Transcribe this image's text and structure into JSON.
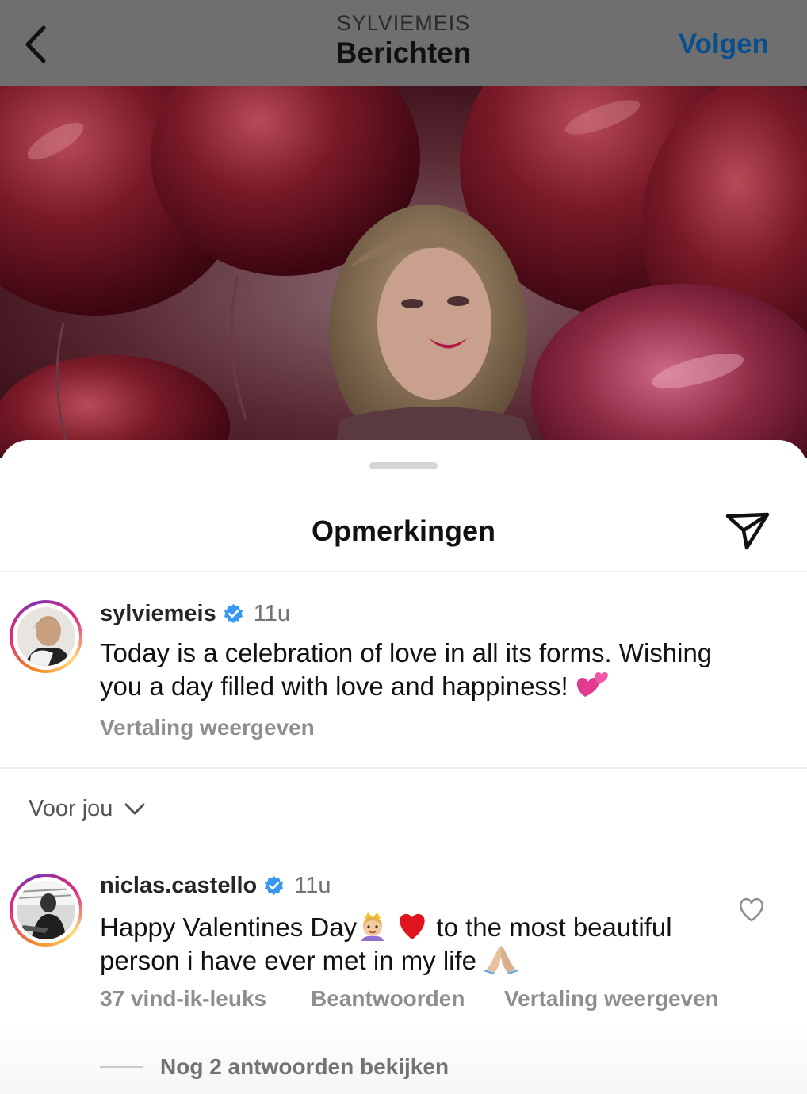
{
  "header": {
    "subtitle": "SYLVIEMEIS",
    "title": "Berichten",
    "follow_label": "Volgen",
    "back_icon": "chevron-left-icon"
  },
  "sheet": {
    "title": "Opmerkingen",
    "share_icon": "send-icon"
  },
  "caption": {
    "username": "sylviemeis",
    "verified": true,
    "time": "11u",
    "text_line1": "Today is a celebration of love in all its forms. Wishing",
    "text_line2": "you a day filled with love and happiness! ",
    "emoji": "two-hearts",
    "translate_label": "Vertaling weergeven"
  },
  "sort": {
    "label": "Voor jou",
    "icon": "chevron-down-icon"
  },
  "comments": [
    {
      "username": "niclas.castello",
      "verified": true,
      "time": "11u",
      "text_part1": "Happy Valentines Day",
      "text_part2": " to the most beautiful",
      "text_line2": "person i have ever met in my life ",
      "emojis": [
        "princess",
        "red-heart",
        "folded-hands"
      ],
      "likes_label": "37 vind-ik-leuks",
      "reply_label": "Beantwoorden",
      "translate_label": "Vertaling weergeven",
      "more_replies_label": "Nog 2 antwoorden bekijken"
    }
  ],
  "colors": {
    "header_bg": "#6f6f6f",
    "follow": "#0a4f8c",
    "verified": "#3897f0",
    "meta": "#8e8e8e"
  }
}
